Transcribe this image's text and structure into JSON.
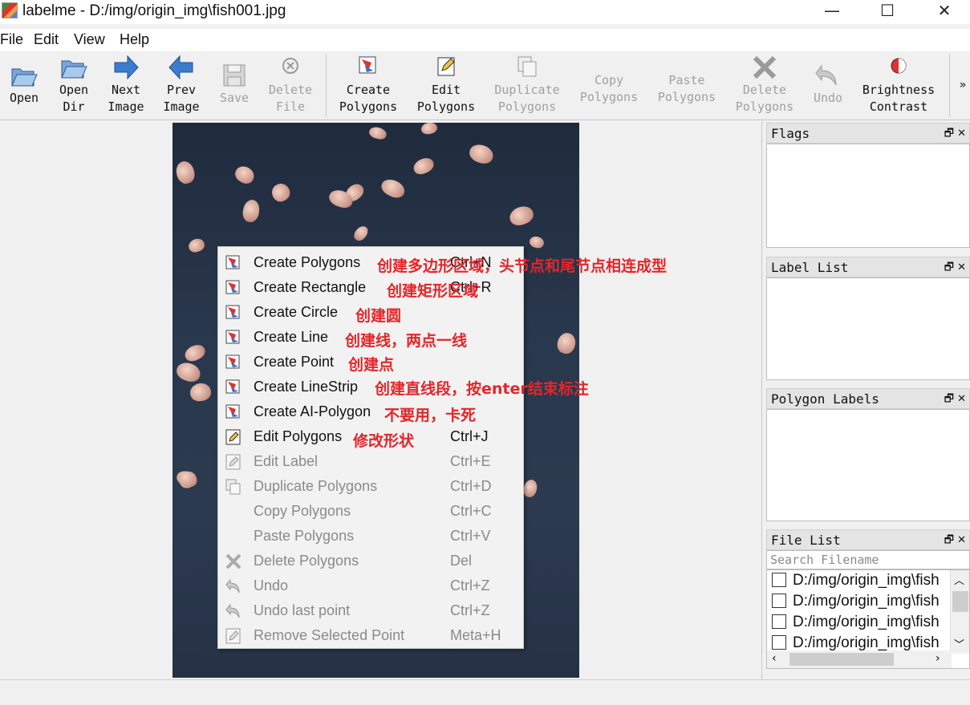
{
  "window": {
    "title": "labelme - D:/img/origin_img\\fish001.jpg",
    "minimize": "—",
    "maximize": "☐",
    "close": "✕"
  },
  "menu": [
    "File",
    "Edit",
    "View",
    "Help"
  ],
  "toolbar": {
    "open": "Open",
    "open_dir": "Open\nDir",
    "next_image": "Next\nImage",
    "prev_image": "Prev\nImage",
    "save": "Save",
    "delete_file": "Delete\nFile",
    "create_polygons": "Create\nPolygons",
    "edit_polygons": "Edit\nPolygons",
    "duplicate_polygons": "Duplicate\nPolygons",
    "copy_polygons": "Copy\nPolygons",
    "paste_polygons": "Paste\nPolygons",
    "delete_polygons": "Delete\nPolygons",
    "undo": "Undo",
    "brightness_contrast": "Brightness\nContrast",
    "more": "»"
  },
  "context_menu": [
    {
      "label": "Create Polygons",
      "shortcut": "Ctrl+N",
      "note": "创建多边形区域，头节点和尾节点相连成型",
      "enabled": true
    },
    {
      "label": "Create Rectangle",
      "shortcut": "Ctrl+R",
      "note": "创建矩形区域",
      "enabled": true
    },
    {
      "label": "Create Circle",
      "shortcut": "",
      "note": "创建圆",
      "enabled": true
    },
    {
      "label": "Create Line",
      "shortcut": "",
      "note": "创建线，两点一线",
      "enabled": true
    },
    {
      "label": "Create Point",
      "shortcut": "",
      "note": "创建点",
      "enabled": true
    },
    {
      "label": "Create LineStrip",
      "shortcut": "",
      "note": "创建直线段，按enter结束标注",
      "enabled": true
    },
    {
      "label": "Create AI-Polygon",
      "shortcut": "",
      "note": "不要用，卡死",
      "enabled": true
    },
    {
      "label": "Edit Polygons",
      "shortcut": "Ctrl+J",
      "note": "修改形状",
      "enabled": true
    },
    {
      "label": "Edit Label",
      "shortcut": "Ctrl+E",
      "note": "",
      "enabled": false
    },
    {
      "label": "Duplicate Polygons",
      "shortcut": "Ctrl+D",
      "note": "",
      "enabled": false
    },
    {
      "label": "Copy Polygons",
      "shortcut": "Ctrl+C",
      "note": "",
      "enabled": false
    },
    {
      "label": "Paste Polygons",
      "shortcut": "Ctrl+V",
      "note": "",
      "enabled": false
    },
    {
      "label": "Delete Polygons",
      "shortcut": "Del",
      "note": "",
      "enabled": false
    },
    {
      "label": "Undo",
      "shortcut": "Ctrl+Z",
      "note": "",
      "enabled": false
    },
    {
      "label": "Undo last point",
      "shortcut": "Ctrl+Z",
      "note": "",
      "enabled": false
    },
    {
      "label": "Remove Selected Point",
      "shortcut": "Meta+H",
      "note": "",
      "enabled": false
    }
  ],
  "docks": {
    "flags": "Flags",
    "label_list": "Label List",
    "polygon_labels": "Polygon Labels",
    "file_list": "File List",
    "float_icon": "🗗",
    "close_icon": "✕"
  },
  "file_list": {
    "search_placeholder": "Search Filename",
    "items": [
      "D:/img/origin_img\\fish",
      "D:/img/origin_img\\fish",
      "D:/img/origin_img\\fish",
      "D:/img/origin_img\\fish"
    ]
  },
  "colors": {
    "annotation": "#e3262a",
    "background": "#f0f0f0"
  }
}
